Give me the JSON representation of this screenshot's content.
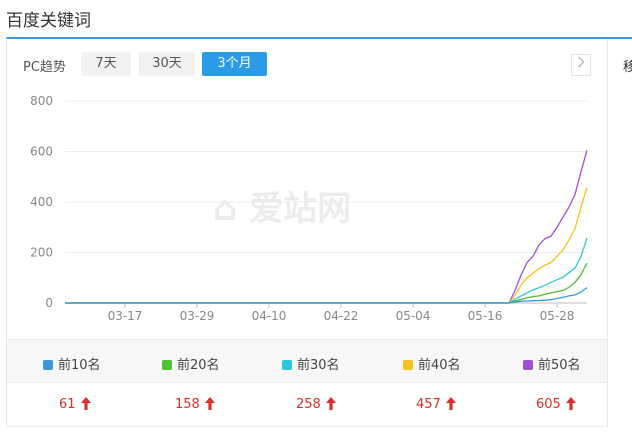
{
  "page": {
    "title": "百度关键词",
    "side_label": "移"
  },
  "toolbar": {
    "trend_label": "PC趋势",
    "ranges": [
      {
        "label": "7天",
        "active": false
      },
      {
        "label": "30天",
        "active": false
      },
      {
        "label": "3个月",
        "active": true
      }
    ],
    "next_icon": "chevron-right-icon"
  },
  "watermark": "爱站网",
  "chart_data": {
    "type": "line",
    "ylim": [
      0,
      800
    ],
    "y_ticks": [
      0,
      200,
      400,
      600,
      800
    ],
    "x_tick_labels": [
      "03-17",
      "03-29",
      "04-10",
      "04-22",
      "05-04",
      "05-16",
      "05-28"
    ],
    "x_start": "03-07",
    "x_end": "06-02",
    "grid": true,
    "legend_position": "bottom",
    "series": [
      {
        "name": "前10名",
        "color": "#3a97de",
        "points": [
          [
            "03-07",
            0
          ],
          [
            "05-20",
            0
          ],
          [
            "05-21",
            4
          ],
          [
            "05-22",
            7
          ],
          [
            "05-23",
            8
          ],
          [
            "05-24",
            9
          ],
          [
            "05-25",
            10
          ],
          [
            "05-26",
            11
          ],
          [
            "05-27",
            13
          ],
          [
            "05-28",
            18
          ],
          [
            "05-29",
            22
          ],
          [
            "05-30",
            28
          ],
          [
            "05-31",
            32
          ],
          [
            "06-01",
            44
          ],
          [
            "06-02",
            61
          ]
        ]
      },
      {
        "name": "前20名",
        "color": "#51c032",
        "points": [
          [
            "03-07",
            0
          ],
          [
            "05-20",
            0
          ],
          [
            "05-21",
            8
          ],
          [
            "05-22",
            15
          ],
          [
            "05-23",
            20
          ],
          [
            "05-24",
            25
          ],
          [
            "05-25",
            28
          ],
          [
            "05-26",
            35
          ],
          [
            "05-27",
            40
          ],
          [
            "05-28",
            45
          ],
          [
            "05-29",
            50
          ],
          [
            "05-30",
            62
          ],
          [
            "05-31",
            82
          ],
          [
            "06-01",
            112
          ],
          [
            "06-02",
            158
          ]
        ]
      },
      {
        "name": "前30名",
        "color": "#2cc7dc",
        "points": [
          [
            "03-07",
            0
          ],
          [
            "05-20",
            0
          ],
          [
            "05-21",
            15
          ],
          [
            "05-22",
            28
          ],
          [
            "05-23",
            40
          ],
          [
            "05-24",
            52
          ],
          [
            "05-25",
            60
          ],
          [
            "05-26",
            70
          ],
          [
            "05-27",
            82
          ],
          [
            "05-28",
            92
          ],
          [
            "05-29",
            102
          ],
          [
            "05-30",
            120
          ],
          [
            "05-31",
            138
          ],
          [
            "06-01",
            185
          ],
          [
            "06-02",
            258
          ]
        ]
      },
      {
        "name": "前40名",
        "color": "#f2c21d",
        "points": [
          [
            "03-07",
            0
          ],
          [
            "05-20",
            0
          ],
          [
            "05-21",
            30
          ],
          [
            "05-22",
            70
          ],
          [
            "05-23",
            100
          ],
          [
            "05-24",
            118
          ],
          [
            "05-25",
            135
          ],
          [
            "05-26",
            150
          ],
          [
            "05-27",
            160
          ],
          [
            "05-28",
            185
          ],
          [
            "05-29",
            210
          ],
          [
            "05-30",
            250
          ],
          [
            "05-31",
            295
          ],
          [
            "06-01",
            380
          ],
          [
            "06-02",
            457
          ]
        ]
      },
      {
        "name": "前50名",
        "color": "#a24edb",
        "points": [
          [
            "03-07",
            0
          ],
          [
            "05-20",
            0
          ],
          [
            "05-21",
            50
          ],
          [
            "05-22",
            110
          ],
          [
            "05-23",
            160
          ],
          [
            "05-24",
            185
          ],
          [
            "05-25",
            230
          ],
          [
            "05-26",
            255
          ],
          [
            "05-27",
            265
          ],
          [
            "05-28",
            300
          ],
          [
            "05-29",
            340
          ],
          [
            "05-30",
            380
          ],
          [
            "05-31",
            430
          ],
          [
            "06-01",
            520
          ],
          [
            "06-02",
            605
          ]
        ]
      }
    ]
  },
  "legend": [
    {
      "label": "前10名",
      "color": "#3a97de"
    },
    {
      "label": "前20名",
      "color": "#51c032"
    },
    {
      "label": "前30名",
      "color": "#2cc7dc"
    },
    {
      "label": "前40名",
      "color": "#f2c21d"
    },
    {
      "label": "前50名",
      "color": "#a24edb"
    }
  ],
  "values": [
    {
      "value": "61",
      "trend": "up",
      "icon": "arrow-up-icon"
    },
    {
      "value": "158",
      "trend": "up",
      "icon": "arrow-up-icon"
    },
    {
      "value": "258",
      "trend": "up",
      "icon": "arrow-up-icon"
    },
    {
      "value": "457",
      "trend": "up",
      "icon": "arrow-up-icon"
    },
    {
      "value": "605",
      "trend": "up",
      "icon": "arrow-up-icon"
    }
  ],
  "colors": {
    "accent": "#2a9be6",
    "trend_up": "#d9302b"
  }
}
